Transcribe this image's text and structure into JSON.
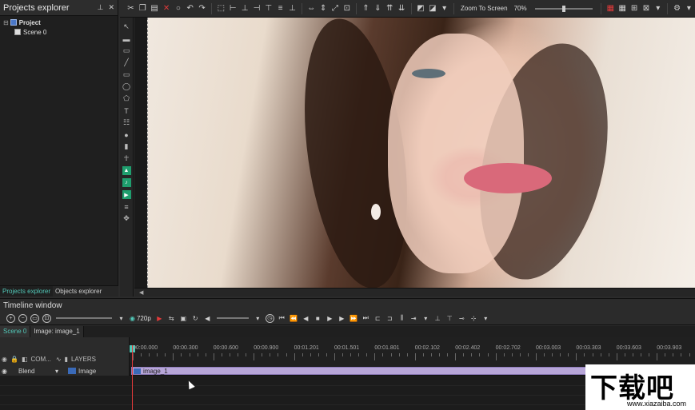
{
  "projects_panel": {
    "title": "Projects explorer",
    "tree": [
      {
        "label": "Project",
        "icon": "project-icon"
      },
      {
        "label": "Scene 0",
        "icon": "scene-icon"
      }
    ],
    "bottom_tabs": [
      "Projects explorer",
      "Objects explorer"
    ]
  },
  "toolbar": {
    "zoom_mode": "Zoom To Screen",
    "zoom_percent": "70%"
  },
  "timeline": {
    "title": "Timeline window",
    "resolution": "720p",
    "tabs": [
      "Scene 0",
      "Image: image_1"
    ],
    "header_labels": {
      "com": "COM...",
      "layers": "LAYERS"
    },
    "ruler_labels": [
      "00:00.000",
      "00:00.300",
      "00:00.600",
      "00:00.900",
      "00:01.201",
      "00:01.501",
      "00:01.801",
      "00:02.102",
      "00:02.402",
      "00:02.702",
      "00:03.003",
      "00:03.303",
      "00:03.603",
      "00:03.903"
    ],
    "rows": [
      {
        "blend": "Blend",
        "layer": "Image",
        "clip": "image_1"
      }
    ]
  },
  "watermark": {
    "main": "下载吧",
    "sub": "www.xiazaiba.com"
  },
  "colors": {
    "accent": "#52c8b8",
    "clip": "#b7a6d8",
    "playhead": "#e23a3a"
  }
}
